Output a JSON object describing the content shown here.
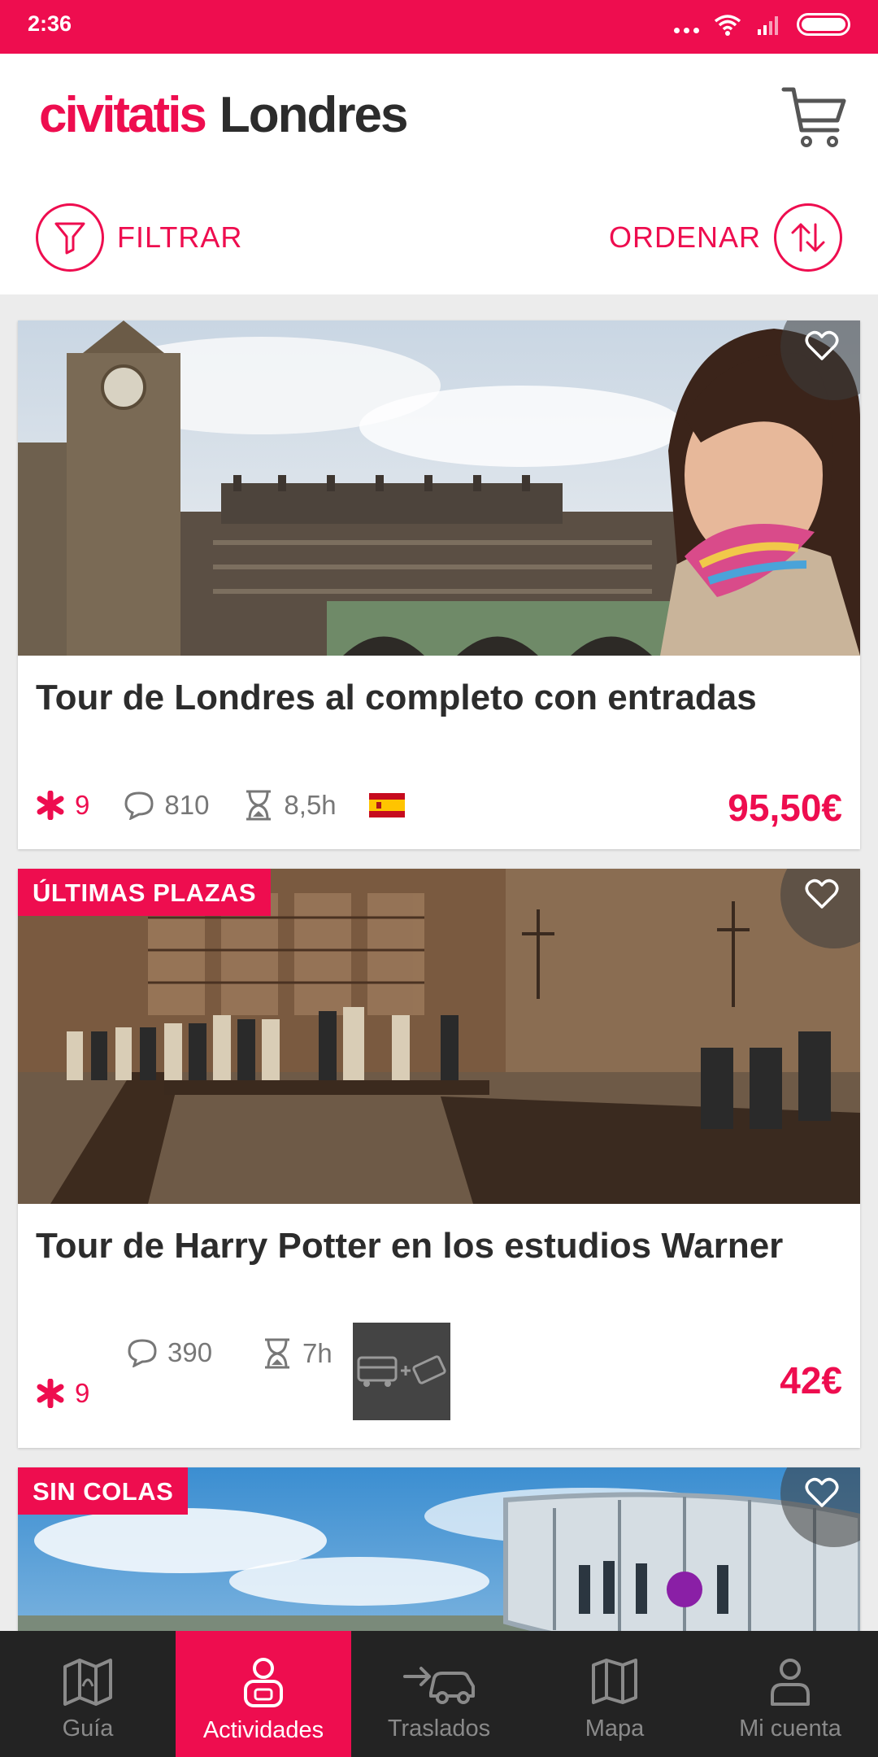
{
  "status": {
    "time": "2:36"
  },
  "header": {
    "logo": "civitatis",
    "city": "Londres"
  },
  "toolbar": {
    "filter_label": "FILTRAR",
    "sort_label": "ORDENAR"
  },
  "colors": {
    "accent": "#ee0d4f",
    "nav_bg": "#232323"
  },
  "activities": [
    {
      "title": "Tour de Londres al completo con entradas",
      "rating": "9",
      "reviews": "810",
      "duration": "8,5h",
      "language_flag": "spain-flag-icon",
      "price": "95,50€",
      "badge": ""
    },
    {
      "title": "Tour de Harry Potter en los estudios Warner",
      "rating": "9",
      "reviews": "390",
      "duration": "7h",
      "extra_icon": "bus-plus-ticket-icon",
      "price": "42€",
      "badge": "ÚLTIMAS PLAZAS"
    },
    {
      "title": "",
      "badge": "SIN COLAS"
    }
  ],
  "nav": [
    {
      "label": "Guía",
      "icon": "map-book-icon",
      "active": false
    },
    {
      "label": "Actividades",
      "icon": "person-icon",
      "active": true
    },
    {
      "label": "Traslados",
      "icon": "car-transfer-icon",
      "active": false
    },
    {
      "label": "Mapa",
      "icon": "map-icon",
      "active": false
    },
    {
      "label": "Mi cuenta",
      "icon": "account-icon",
      "active": false
    }
  ]
}
